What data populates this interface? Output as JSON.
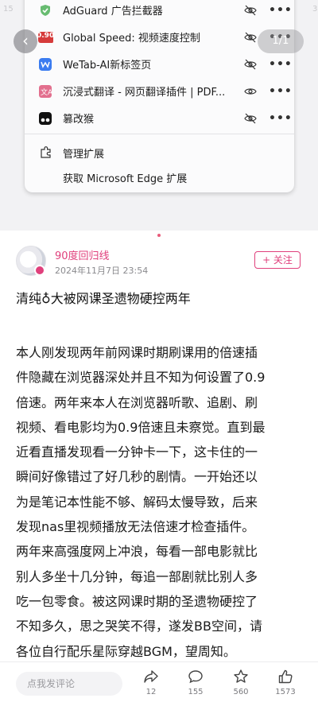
{
  "screenshot": {
    "extensions": [
      {
        "name": "AdGuard 广告拦截器",
        "icon": "adguard-shield-icon",
        "visibility": "hidden-eye-icon"
      },
      {
        "name": "Global Speed: 视频速度控制",
        "icon": "speed-badge-icon",
        "badge": "0.90",
        "visibility": "hidden-eye-icon"
      },
      {
        "name": "WeTab-AI新标签页",
        "icon": "wetab-icon",
        "visibility": "hidden-eye-icon"
      },
      {
        "name": "沉浸式翻译 - 网页翻译插件 | PDF...",
        "icon": "translate-icon",
        "visibility": "eye-icon"
      },
      {
        "name": "篡改猴",
        "icon": "tampermonkey-icon",
        "visibility": "hidden-eye-icon"
      }
    ],
    "manage_label": "管理扩展",
    "get_label": "获取 Microsoft Edge 扩展",
    "page_indicator": "1/1",
    "ghost_left": "15",
    "ghost_right": "3"
  },
  "post": {
    "author": "90度回归线",
    "date": "2024年11月7日 23:54",
    "follow_label": "+ 关注",
    "title": "清纯♁大被网课圣遗物硬控两年",
    "body_lines": [
      "本人刚发现两年前网课时期刷课用的倍速插",
      "件隐藏在浏览器深处并且不知为何设置了0.9",
      "倍速。两年来本人在浏览器听歌、追剧、刷",
      "视频、看电影均为0.9倍速且未察觉。直到最",
      "近看直播发现看一分钟卡一下，这卡住的一",
      "瞬间好像错过了好几秒的剧情。一开始还以",
      "为是笔记本性能不够、解码太慢导致，后来",
      "发现nas里视频播放无法倍速才检查插件。",
      "两年来高强度网上冲浪，每看一部电影就比",
      "别人多坐十几分钟，每追一部剧就比别人多",
      "吃一包零食。被这网课时期的圣遗物硬控了",
      "不知多久，思之哭笑不得，遂发BB空间，请",
      "各位自行配乐星际穿越BGM，望周知。"
    ]
  },
  "bottom": {
    "comment_placeholder": "点我发评论",
    "share_count": "12",
    "comment_count": "155",
    "star_count": "560",
    "like_count": "1573"
  },
  "colors": {
    "accent": "#e0407c"
  }
}
